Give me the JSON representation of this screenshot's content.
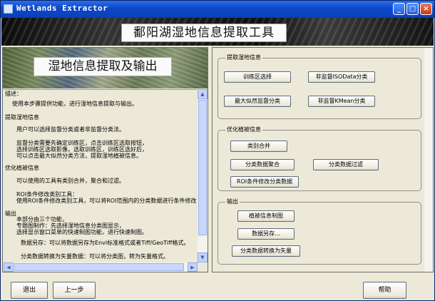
{
  "window": {
    "title": "Wetlands Extractor",
    "controls": {
      "minimize": "_",
      "maximize": "□",
      "close": "×"
    }
  },
  "banner": {
    "title": "鄱阳湖湿地信息提取工具"
  },
  "left_panel": {
    "image_caption": "湿地信息提取及输出",
    "text_lines": [
      "描述：",
      "使用本步骤提供功能，进行湿地信息提取与输出。",
      "提取湿地信息",
      "用户可以选择监督分类或者非监督分类法。",
      "监督分类需要先确定训练区，点击训练区选取按钮，",
      "选择训练区选取影像，选取训练区，训练区选好后，",
      "可以点击最大似然分类方法，提取湿地植被信息。",
      "优化植被信息",
      "可以使用的工具有类别合并，聚合和过滤。",
      "ROI条件修改类别工具：",
      "使用ROI条件修改类别工具，可以将ROI范围内的分类数据进行条件修改",
      "输出",
      "本部分由三个功能，",
      "专题图制作：先选择湿地信息分类图显示，",
      "选择显示窗口菜单的快速制图功能，进行快速制图。",
      "数据另存：可以将数据另存为Envi标准格式或者Tiff/GeoTiff格式。",
      "分类数据转换为矢量数据：可以将分类图，转为矢量格式。"
    ]
  },
  "groups": {
    "extract": {
      "title": "提取湿地信息",
      "buttons": [
        "训练区选择",
        "非监督ISOData分类",
        "最大似然监督分类",
        "非监督KMean分类"
      ]
    },
    "optimize": {
      "title": "优化植被信息",
      "buttons": [
        "类别合并",
        "分类数据聚合",
        "分类数据过滤",
        "ROI条件修改分类数据"
      ]
    },
    "output": {
      "title": "输出",
      "buttons": [
        "植被信息制图",
        "数据另存...",
        "分类数据转换为矢量"
      ]
    }
  },
  "footer": {
    "exit": "退出",
    "prev": "上一步",
    "help": "帮助"
  },
  "icons": {
    "scroll_up": "arrow-up-icon",
    "scroll_down": "arrow-down-icon",
    "scroll_left": "arrow-left-icon",
    "scroll_right": "arrow-right-icon"
  },
  "colors": {
    "titlebar": "#0d47c9",
    "window_bg": "#ece9d8",
    "close_button": "#c7381a"
  }
}
